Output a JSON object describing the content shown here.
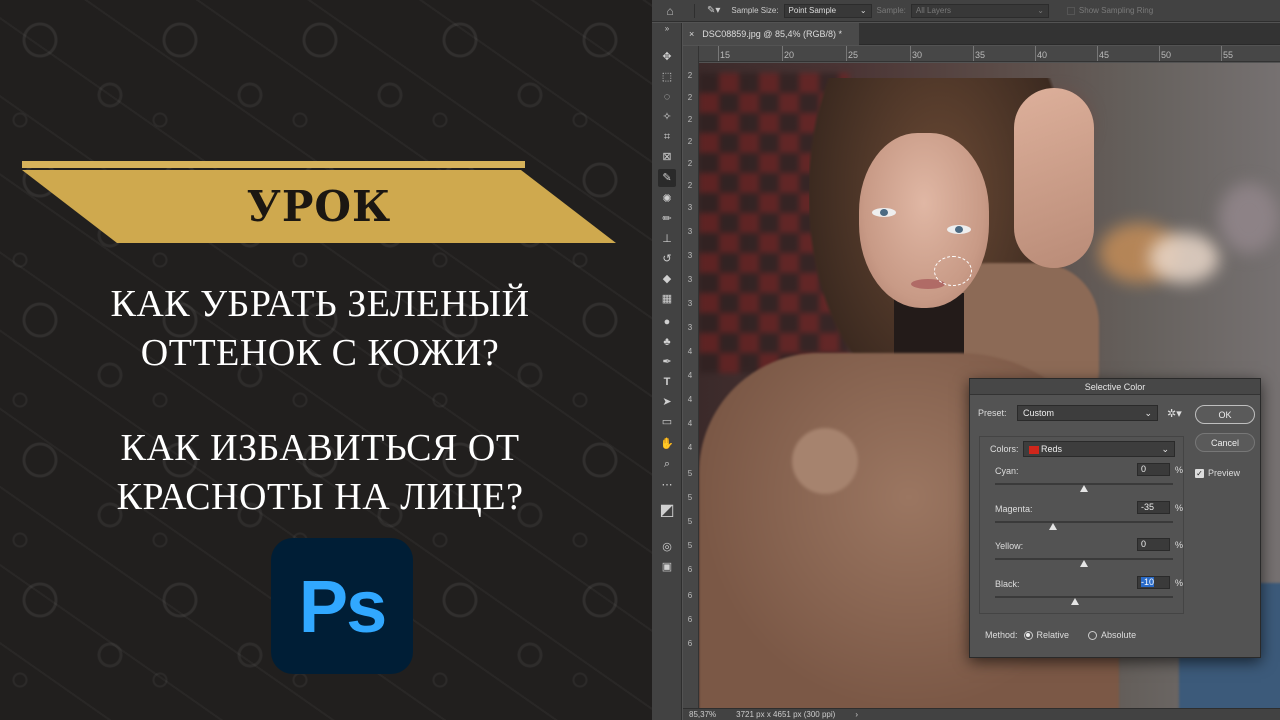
{
  "promo": {
    "banner": "УРОК",
    "headline1": [
      "КАК УБРАТЬ ЗЕЛЕНЫЙ",
      "ОТТЕНОК С КОЖИ?"
    ],
    "headline2": [
      "КАК ИЗБАВИТЬСЯ ОТ",
      "КРАСНОТЫ НА ЛИЦЕ?"
    ],
    "logo": "Ps",
    "colors": {
      "gold": "#cfa94e",
      "ps_bg": "#001e36",
      "ps_text": "#31a8ff"
    }
  },
  "options_bar": {
    "sample_size_label": "Sample Size:",
    "sample_size_value": "Point Sample",
    "sample_label": "Sample:",
    "sample_value": "All Layers",
    "show_ring": "Show Sampling Ring"
  },
  "document": {
    "tab_title": "DSC08859.jpg @ 85,4% (RGB/8) *",
    "close_symbol": "×",
    "ruler_h": [
      "15",
      "20",
      "25",
      "30",
      "35",
      "40",
      "45",
      "50",
      "55"
    ],
    "ruler_v": [
      "2",
      "2",
      "2",
      "2",
      "2",
      "2",
      "3",
      "3",
      "3",
      "3",
      "3",
      "3",
      "4",
      "4",
      "4",
      "4",
      "4",
      "5",
      "5",
      "5",
      "5",
      "6",
      "6",
      "6",
      "6"
    ]
  },
  "status": {
    "zoom": "85,37%",
    "info": "3721 px x 4651 px (300 ppi)",
    "arrow": "›"
  },
  "dialog": {
    "title": "Selective Color",
    "preset_label": "Preset:",
    "preset_value": "Custom",
    "colors_label": "Colors:",
    "colors_value": "Reds",
    "sliders": [
      {
        "name": "Cyan:",
        "value": "0",
        "fraction": 0.5
      },
      {
        "name": "Magenta:",
        "value": "-35",
        "fraction": 0.325
      },
      {
        "name": "Yellow:",
        "value": "0",
        "fraction": 0.5
      },
      {
        "name": "Black:",
        "value": "-10",
        "fraction": 0.45
      }
    ],
    "pct": "%",
    "ok": "OK",
    "cancel": "Cancel",
    "preview_label": "Preview",
    "preview_checked": true,
    "method_label": "Method:",
    "method_relative": "Relative",
    "method_absolute": "Absolute",
    "method_selected": "Relative"
  }
}
